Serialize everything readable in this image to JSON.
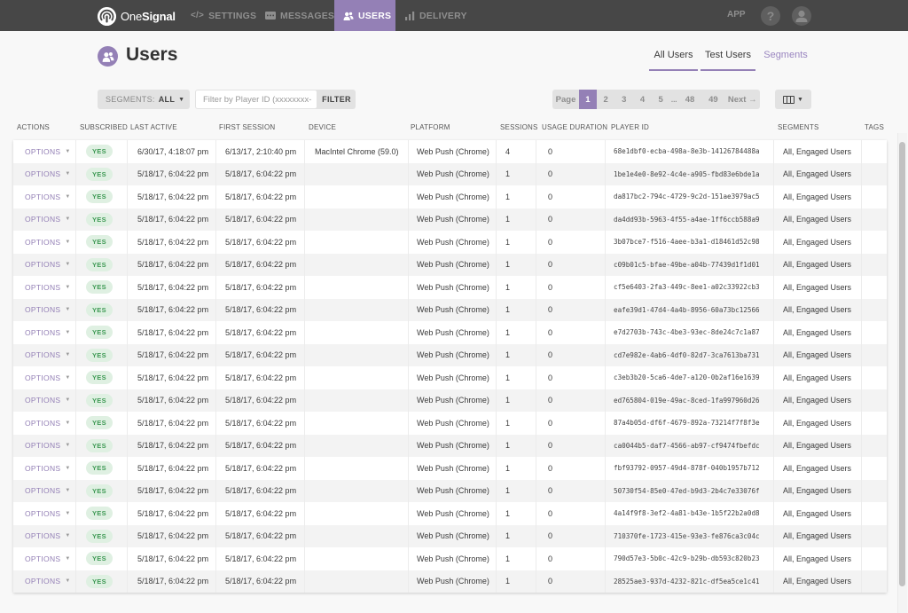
{
  "nav": {
    "brand_light": "One",
    "brand_bold": "Signal",
    "items": [
      {
        "label": "SETTINGS",
        "icon": "code-icon"
      },
      {
        "label": "MESSAGES",
        "icon": "message-icon"
      },
      {
        "label": "USERS",
        "icon": "users-icon",
        "active": true
      },
      {
        "label": "DELIVERY",
        "icon": "bar-chart-icon"
      }
    ],
    "app_label": "APP",
    "help_label": "?"
  },
  "header": {
    "title": "Users",
    "tabs": [
      {
        "label": "All Users"
      },
      {
        "label": "Test Users"
      },
      {
        "label": "Segments"
      }
    ]
  },
  "toolbar": {
    "segments_label": "SEGMENTS:",
    "segments_value": "ALL",
    "filter_placeholder": "Filter by Player ID (xxxxxxxx-",
    "filter_value": "",
    "filter_button": "FILTER",
    "pager": {
      "label": "Page",
      "pages": [
        "1",
        "2",
        "3",
        "4",
        "5"
      ],
      "ellipsis": "...",
      "tail_pages": [
        "48",
        "49"
      ],
      "current": "1",
      "next": "Next →"
    }
  },
  "table": {
    "columns": [
      "ACTIONS",
      "SUBSCRIBED",
      "LAST ACTIVE",
      "FIRST SESSION",
      "DEVICE",
      "PLATFORM",
      "SESSIONS",
      "USAGE DURATION",
      "PLAYER ID",
      "SEGMENTS",
      "TAGS"
    ],
    "options_label": "OPTIONS",
    "rows": [
      {
        "subscribed": "YES",
        "last_active": "6/30/17, 4:18:07 pm",
        "first_session": "6/13/17, 2:10:40 pm",
        "device": "MacIntel Chrome (59.0)",
        "platform": "Web Push (Chrome)",
        "sessions": "4",
        "usage": "0",
        "player_id": "68e1dbf0-ecba-498a-8e3b-14126784488a",
        "segments": "All, Engaged Users",
        "tags": ""
      },
      {
        "subscribed": "YES",
        "last_active": "5/18/17, 6:04:22 pm",
        "first_session": "5/18/17, 6:04:22 pm",
        "device": "",
        "platform": "Web Push (Chrome)",
        "sessions": "1",
        "usage": "0",
        "player_id": "1be1e4e0-8e92-4c4e-a905-fbd83e6bde1a",
        "segments": "All, Engaged Users",
        "tags": ""
      },
      {
        "subscribed": "YES",
        "last_active": "5/18/17, 6:04:22 pm",
        "first_session": "5/18/17, 6:04:22 pm",
        "device": "",
        "platform": "Web Push (Chrome)",
        "sessions": "1",
        "usage": "0",
        "player_id": "da817bc2-794c-4729-9c2d-151ae3979ac5",
        "segments": "All, Engaged Users",
        "tags": ""
      },
      {
        "subscribed": "YES",
        "last_active": "5/18/17, 6:04:22 pm",
        "first_session": "5/18/17, 6:04:22 pm",
        "device": "",
        "platform": "Web Push (Chrome)",
        "sessions": "1",
        "usage": "0",
        "player_id": "da4dd93b-5963-4f55-a4ae-1ff6ccb588a9",
        "segments": "All, Engaged Users",
        "tags": ""
      },
      {
        "subscribed": "YES",
        "last_active": "5/18/17, 6:04:22 pm",
        "first_session": "5/18/17, 6:04:22 pm",
        "device": "",
        "platform": "Web Push (Chrome)",
        "sessions": "1",
        "usage": "0",
        "player_id": "3b07bce7-f516-4aee-b3a1-d18461d52c98",
        "segments": "All, Engaged Users",
        "tags": ""
      },
      {
        "subscribed": "YES",
        "last_active": "5/18/17, 6:04:22 pm",
        "first_session": "5/18/17, 6:04:22 pm",
        "device": "",
        "platform": "Web Push (Chrome)",
        "sessions": "1",
        "usage": "0",
        "player_id": "c09b01c5-bfae-49be-a04b-77439d1f1d01",
        "segments": "All, Engaged Users",
        "tags": ""
      },
      {
        "subscribed": "YES",
        "last_active": "5/18/17, 6:04:22 pm",
        "first_session": "5/18/17, 6:04:22 pm",
        "device": "",
        "platform": "Web Push (Chrome)",
        "sessions": "1",
        "usage": "0",
        "player_id": "cf5e6403-2fa3-449c-8ee1-a02c33922cb3",
        "segments": "All, Engaged Users",
        "tags": ""
      },
      {
        "subscribed": "YES",
        "last_active": "5/18/17, 6:04:22 pm",
        "first_session": "5/18/17, 6:04:22 pm",
        "device": "",
        "platform": "Web Push (Chrome)",
        "sessions": "1",
        "usage": "0",
        "player_id": "eafe39d1-47d4-4a4b-8956-60a73bc12566",
        "segments": "All, Engaged Users",
        "tags": ""
      },
      {
        "subscribed": "YES",
        "last_active": "5/18/17, 6:04:22 pm",
        "first_session": "5/18/17, 6:04:22 pm",
        "device": "",
        "platform": "Web Push (Chrome)",
        "sessions": "1",
        "usage": "0",
        "player_id": "e7d2703b-743c-4be3-93ec-8de24c7c1a87",
        "segments": "All, Engaged Users",
        "tags": ""
      },
      {
        "subscribed": "YES",
        "last_active": "5/18/17, 6:04:22 pm",
        "first_session": "5/18/17, 6:04:22 pm",
        "device": "",
        "platform": "Web Push (Chrome)",
        "sessions": "1",
        "usage": "0",
        "player_id": "cd7e982e-4ab6-4df0-82d7-3ca7613ba731",
        "segments": "All, Engaged Users",
        "tags": ""
      },
      {
        "subscribed": "YES",
        "last_active": "5/18/17, 6:04:22 pm",
        "first_session": "5/18/17, 6:04:22 pm",
        "device": "",
        "platform": "Web Push (Chrome)",
        "sessions": "1",
        "usage": "0",
        "player_id": "c3eb3b20-5ca6-4de7-a120-0b2af16e1639",
        "segments": "All, Engaged Users",
        "tags": ""
      },
      {
        "subscribed": "YES",
        "last_active": "5/18/17, 6:04:22 pm",
        "first_session": "5/18/17, 6:04:22 pm",
        "device": "",
        "platform": "Web Push (Chrome)",
        "sessions": "1",
        "usage": "0",
        "player_id": "ed765804-019e-49ac-8ced-1fa997960d26",
        "segments": "All, Engaged Users",
        "tags": ""
      },
      {
        "subscribed": "YES",
        "last_active": "5/18/17, 6:04:22 pm",
        "first_session": "5/18/17, 6:04:22 pm",
        "device": "",
        "platform": "Web Push (Chrome)",
        "sessions": "1",
        "usage": "0",
        "player_id": "87a4b05d-df6f-4679-892a-73214f7f8f3e",
        "segments": "All, Engaged Users",
        "tags": ""
      },
      {
        "subscribed": "YES",
        "last_active": "5/18/17, 6:04:22 pm",
        "first_session": "5/18/17, 6:04:22 pm",
        "device": "",
        "platform": "Web Push (Chrome)",
        "sessions": "1",
        "usage": "0",
        "player_id": "ca0044b5-daf7-4566-ab97-cf9474fbefdc",
        "segments": "All, Engaged Users",
        "tags": ""
      },
      {
        "subscribed": "YES",
        "last_active": "5/18/17, 6:04:22 pm",
        "first_session": "5/18/17, 6:04:22 pm",
        "device": "",
        "platform": "Web Push (Chrome)",
        "sessions": "1",
        "usage": "0",
        "player_id": "fbf93792-0957-49d4-878f-040b1957b712",
        "segments": "All, Engaged Users",
        "tags": ""
      },
      {
        "subscribed": "YES",
        "last_active": "5/18/17, 6:04:22 pm",
        "first_session": "5/18/17, 6:04:22 pm",
        "device": "",
        "platform": "Web Push (Chrome)",
        "sessions": "1",
        "usage": "0",
        "player_id": "50730f54-85e0-47ed-b9d3-2b4c7e33076f",
        "segments": "All, Engaged Users",
        "tags": ""
      },
      {
        "subscribed": "YES",
        "last_active": "5/18/17, 6:04:22 pm",
        "first_session": "5/18/17, 6:04:22 pm",
        "device": "",
        "platform": "Web Push (Chrome)",
        "sessions": "1",
        "usage": "0",
        "player_id": "4a14f9f8-3ef2-4a81-b43e-1b5f22b2a0d8",
        "segments": "All, Engaged Users",
        "tags": ""
      },
      {
        "subscribed": "YES",
        "last_active": "5/18/17, 6:04:22 pm",
        "first_session": "5/18/17, 6:04:22 pm",
        "device": "",
        "platform": "Web Push (Chrome)",
        "sessions": "1",
        "usage": "0",
        "player_id": "710370fe-1723-415e-93e3-fe876ca3c04c",
        "segments": "All, Engaged Users",
        "tags": ""
      },
      {
        "subscribed": "YES",
        "last_active": "5/18/17, 6:04:22 pm",
        "first_session": "5/18/17, 6:04:22 pm",
        "device": "",
        "platform": "Web Push (Chrome)",
        "sessions": "1",
        "usage": "0",
        "player_id": "790d57e3-5b0c-42c9-b29b-db593c820b23",
        "segments": "All, Engaged Users",
        "tags": ""
      },
      {
        "subscribed": "YES",
        "last_active": "5/18/17, 6:04:22 pm",
        "first_session": "5/18/17, 6:04:22 pm",
        "device": "",
        "platform": "Web Push (Chrome)",
        "sessions": "1",
        "usage": "0",
        "player_id": "28525ae3-937d-4232-821c-df5ea5ce1c41",
        "segments": "All, Engaged Users",
        "tags": ""
      }
    ]
  },
  "colors": {
    "accent": "#9480b6",
    "nav_bg": "#474747",
    "badge_bg": "#dff0e2",
    "badge_text": "#3f9a55"
  }
}
